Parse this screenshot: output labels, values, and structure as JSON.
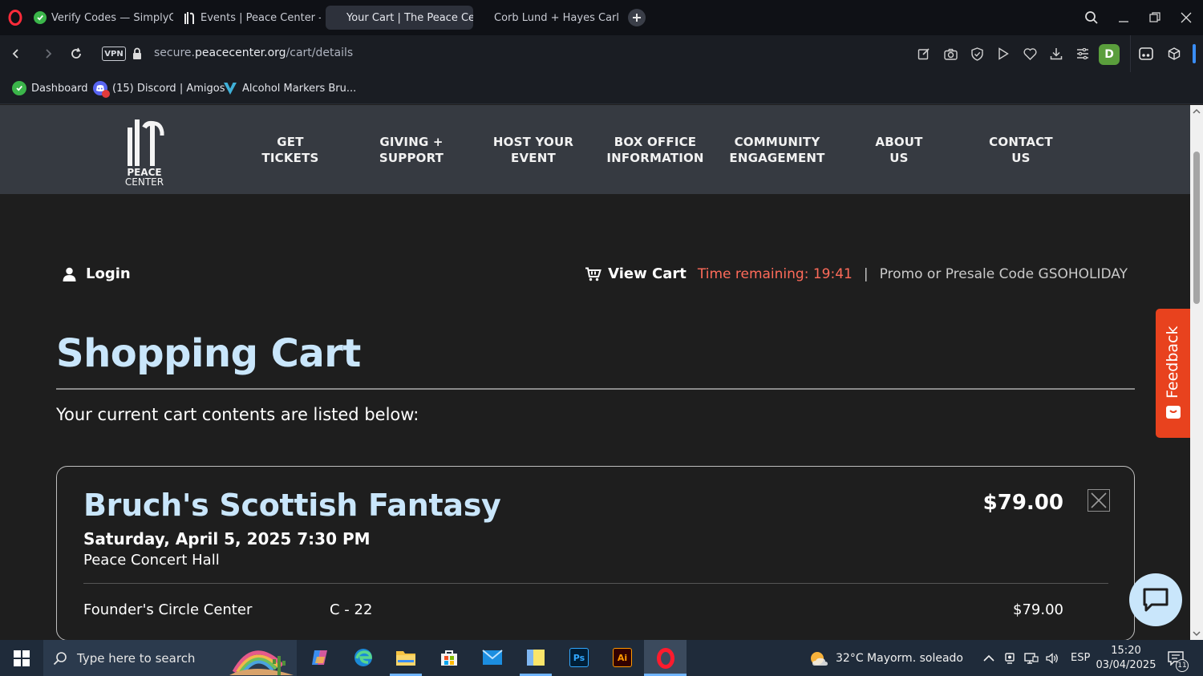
{
  "browser": {
    "tabs": [
      {
        "title": "Verify Codes — SimplyCodes",
        "active": false
      },
      {
        "title": "Events | Peace Center - Official",
        "active": false
      },
      {
        "title": "Your Cart | The Peace Center",
        "active": true
      },
      {
        "title": "Corb Lund + Hayes Carll: ",
        "active": false
      }
    ],
    "vpn_label": "VPN",
    "url_prefix": "secure.",
    "url_domain": "peacecenter.org",
    "url_path": "/cart/details",
    "profile_initial": "D",
    "bookmarks": [
      {
        "label": "Dashboard"
      },
      {
        "label": "(15) Discord | Amigos"
      },
      {
        "label": "Alcohol Markers Bru..."
      }
    ]
  },
  "site": {
    "logo_line1": "PEACE",
    "logo_line2": "CENTER",
    "nav": [
      {
        "line1": "GET",
        "line2": "TICKETS"
      },
      {
        "line1": "GIVING +",
        "line2": "SUPPORT"
      },
      {
        "line1": "HOST YOUR",
        "line2": "EVENT"
      },
      {
        "line1": "BOX OFFICE",
        "line2": "INFORMATION"
      },
      {
        "line1": "COMMUNITY",
        "line2": "ENGAGEMENT"
      },
      {
        "line1": "ABOUT",
        "line2": "US"
      },
      {
        "line1": "CONTACT",
        "line2": "US"
      }
    ],
    "login_label": "Login",
    "view_cart_label": "View Cart",
    "time_remaining": "Time remaining: 19:41",
    "separator": "|",
    "promo": "Promo or Presale Code GSOHOLIDAY"
  },
  "cart": {
    "title": "Shopping Cart",
    "subtitle": "Your current cart contents are listed below:",
    "items": [
      {
        "event": "Bruch's Scottish Fantasy",
        "date": "Saturday, April 5, 2025 7:30 PM",
        "venue": "Peace Concert Hall",
        "price": "$79.00",
        "seat_section": "Founder's Circle Center",
        "seat": "C - 22",
        "seat_price": "$79.00"
      }
    ]
  },
  "widgets": {
    "feedback_label": "Feedback"
  },
  "taskbar": {
    "search_placeholder": "Type here to search",
    "weather": "32°C  Mayorm. soleado",
    "language": "ESP",
    "time": "15:20",
    "date": "03/04/2025",
    "notification_count": "11"
  },
  "colors": {
    "accent_light_blue": "#c9e6fb",
    "timer_red": "#ff6b5a",
    "feedback_orange": "#e8421e",
    "nav_bg": "#363a41"
  }
}
